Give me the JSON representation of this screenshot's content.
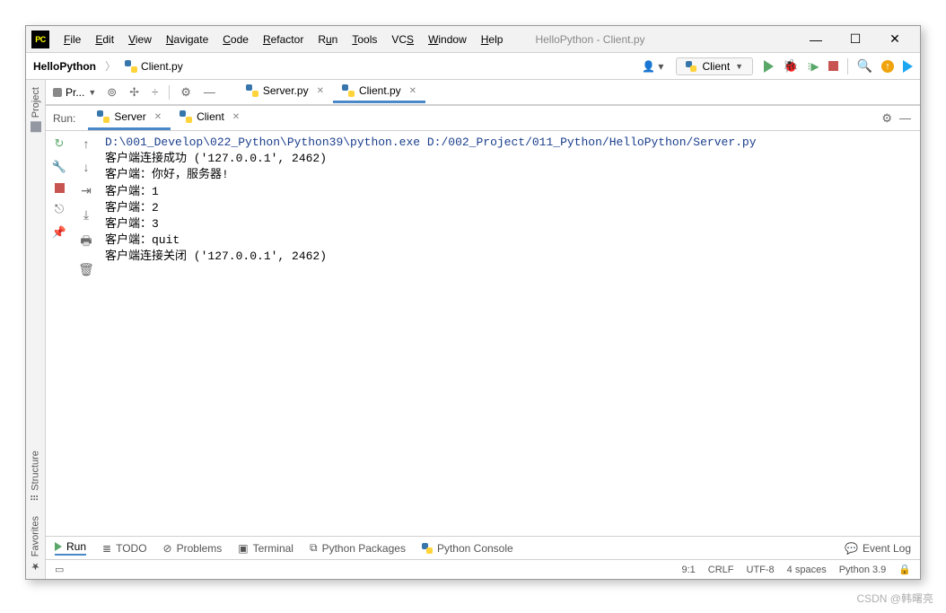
{
  "window": {
    "title": "HelloPython - Client.py"
  },
  "menu": {
    "items": [
      "File",
      "Edit",
      "View",
      "Navigate",
      "Code",
      "Refactor",
      "Run",
      "Tools",
      "VCS",
      "Window",
      "Help"
    ]
  },
  "breadcrumb": {
    "root": "HelloPython",
    "file": "Client.py"
  },
  "run_config": {
    "name": "Client"
  },
  "projbar": {
    "label": "Pr..."
  },
  "editor_tabs": [
    {
      "name": "Server.py",
      "active": false
    },
    {
      "name": "Client.py",
      "active": true
    }
  ],
  "run": {
    "label": "Run:",
    "tabs": [
      {
        "name": "Server",
        "active": true
      },
      {
        "name": "Client",
        "active": false
      }
    ],
    "lines": [
      {
        "cls": "path",
        "text": "D:\\001_Develop\\022_Python\\Python39\\python.exe D:/002_Project/011_Python/HelloPython/Server.py"
      },
      {
        "cls": "",
        "text": "客户端连接成功 ('127.0.0.1', 2462)"
      },
      {
        "cls": "",
        "text": "客户端：你好，服务器!"
      },
      {
        "cls": "",
        "text": "客户端：1"
      },
      {
        "cls": "",
        "text": "客户端：2"
      },
      {
        "cls": "",
        "text": "客户端：3"
      },
      {
        "cls": "",
        "text": "客户端：quit"
      },
      {
        "cls": "",
        "text": "客户端连接关闭 ('127.0.0.1', 2462)"
      }
    ]
  },
  "left_rail": {
    "project": "Project",
    "structure": "Structure",
    "favorites": "Favorites"
  },
  "bottom_tabs": {
    "run": "Run",
    "todo": "TODO",
    "problems": "Problems",
    "terminal": "Terminal",
    "pypkg": "Python Packages",
    "pyconsole": "Python Console",
    "eventlog": "Event Log"
  },
  "status": {
    "pos": "9:1",
    "eol": "CRLF",
    "enc": "UTF-8",
    "indent": "4 spaces",
    "sdk": "Python 3.9"
  },
  "watermark": "CSDN @韩曙亮"
}
